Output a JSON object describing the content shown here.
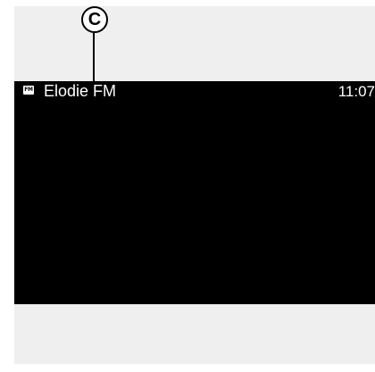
{
  "radio": {
    "band_icon": "FM",
    "station_name": "Elodie FM",
    "time": "11:07"
  },
  "callout": {
    "label": "C"
  },
  "icons": {
    "band": "fm-band-icon"
  },
  "colors": {
    "screen_background": "#000000",
    "panel_background": "#efefef",
    "text": "#ffffff"
  }
}
